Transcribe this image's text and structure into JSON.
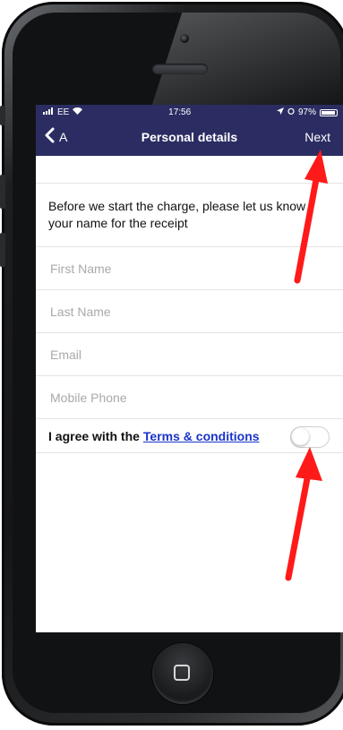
{
  "status_bar": {
    "carrier": "EE",
    "time": "17:56",
    "battery": "97%"
  },
  "nav": {
    "back_label": "A",
    "title": "Personal details",
    "next_label": "Next"
  },
  "form": {
    "intro": "Before we start the charge, please let us know your name for the receipt",
    "first_name": {
      "placeholder": "First Name",
      "value": ""
    },
    "last_name": {
      "placeholder": "Last Name",
      "value": ""
    },
    "email": {
      "placeholder": "Email",
      "value": ""
    },
    "mobile": {
      "placeholder": "Mobile Phone",
      "value": ""
    },
    "agree_text": "I agree with the",
    "terms_link": "Terms & conditions",
    "terms_accepted": false
  },
  "colors": {
    "nav_background": "#2b2d62",
    "link": "#1a33c9",
    "annotation_arrow": "#ff1a1a"
  }
}
